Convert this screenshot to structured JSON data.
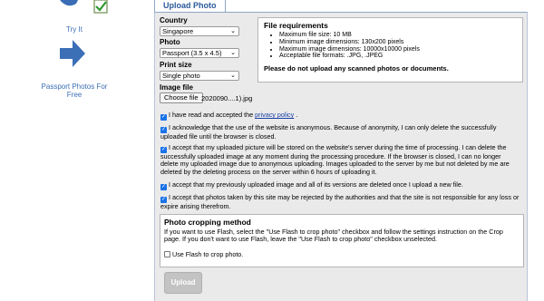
{
  "promo": {
    "try_it": "Try It",
    "passport_link": "Passport Photos For Free",
    "accent": "#3b6fb6",
    "icons": [
      "checkmark-badge-icon",
      "arrow-right-icon"
    ]
  },
  "tab": {
    "label": "Upload Photo"
  },
  "form": {
    "country_label": "Country",
    "country_value": "Singapore",
    "photo_label": "Photo",
    "photo_value": "Passport (3.5 x 4.5)",
    "print_size_label": "Print size",
    "print_size_value": "Single photo",
    "image_file_label": "Image file",
    "choose_file_label": "Choose file",
    "file_name": "2020090....1).jpg"
  },
  "requirements": {
    "title": "File requirements",
    "items": [
      "Maximum file size: 10 MB",
      "Minimum image dimensions: 130x200 pixels",
      "Maximum image dimensions: 10000x10000 pixels",
      "Acceptable file formats: .JPG, .JPEG"
    ],
    "note": "Please do not upload any scanned photos or documents."
  },
  "agreements": [
    {
      "text": "I have read and accepted the ",
      "link": "privacy policy",
      "after": " .",
      "checked": true
    },
    {
      "text": "I acknowledge that the use of the website is anonymous. Because of anonymity, I can only delete the successfully uploaded file until the browser is closed.",
      "checked": true
    },
    {
      "text": "I accept that my uploaded picture will be stored on the website's server during the time of processing. I can delete the successfully uploaded image at any moment during the processing procedure. If the browser is closed, I can no longer delete my uploaded image due to anonymous uploading. Images uploaded to the server by me but not deleted by me are deleted by the deleting process on the server within 6 hours of uploading it.",
      "checked": true
    },
    {
      "text": "I accept that my previously uploaded image and all of its versions are deleted once I upload a new file.",
      "checked": true
    },
    {
      "text": "I accept that photos taken by this site may be rejected by the authorities and that the site is not responsible for any loss or expire arising therefrom.",
      "checked": true
    }
  ],
  "crop": {
    "title": "Photo cropping method",
    "text": "If you want to use Flash, select the \"Use Flash to crop photo\" checkbox and follow the settings instruction on the Crop page. If you don't want to use Flash, leave the \"Use Flash to crop photo\" checkbox unselected.",
    "checkbox_label": "Use Flash to crop photo.",
    "checked": false
  },
  "upload_button": "Upload",
  "colors": {
    "checkbox": "#1a73e8",
    "link": "#1a3fa8",
    "tab_text": "#2a5a9a",
    "panel_bg": "#eaeaea",
    "disabled_button": "#c3c3c3"
  }
}
